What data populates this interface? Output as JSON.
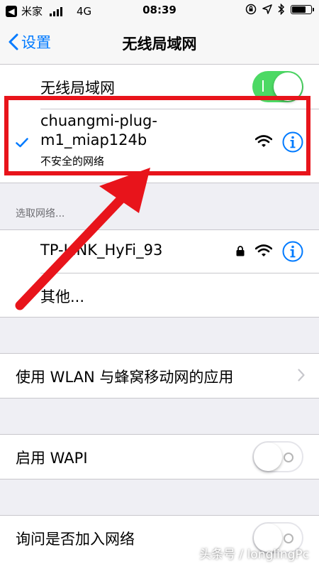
{
  "status_bar": {
    "carrier": "米家",
    "network": "4G",
    "time": "08:39",
    "battery_level": 0.8
  },
  "nav": {
    "back_label": "设置",
    "title": "无线局域网"
  },
  "wifi_toggle": {
    "label": "无线局域网",
    "on": true
  },
  "connected_network": {
    "name_line1": "chuangmi-plug-",
    "name_line2": "m1_miap124b",
    "subtitle": "不安全的网络"
  },
  "choose_network": {
    "header": "选取网络...",
    "networks": [
      {
        "name": "TP-LINK_HyFi_93",
        "locked": true
      }
    ],
    "other_label": "其他..."
  },
  "wlan_apps": {
    "label": "使用 WLAN 与蜂窝移动网的应用"
  },
  "wapi": {
    "label": "启用 WAPI",
    "on": false
  },
  "ask_join": {
    "label": "询问是否加入网络",
    "on": false
  },
  "watermark": "头条号 / longlingPc",
  "colors": {
    "accent": "#007aff",
    "toggle_on": "#4cd964",
    "annotation": "#e8141b"
  }
}
